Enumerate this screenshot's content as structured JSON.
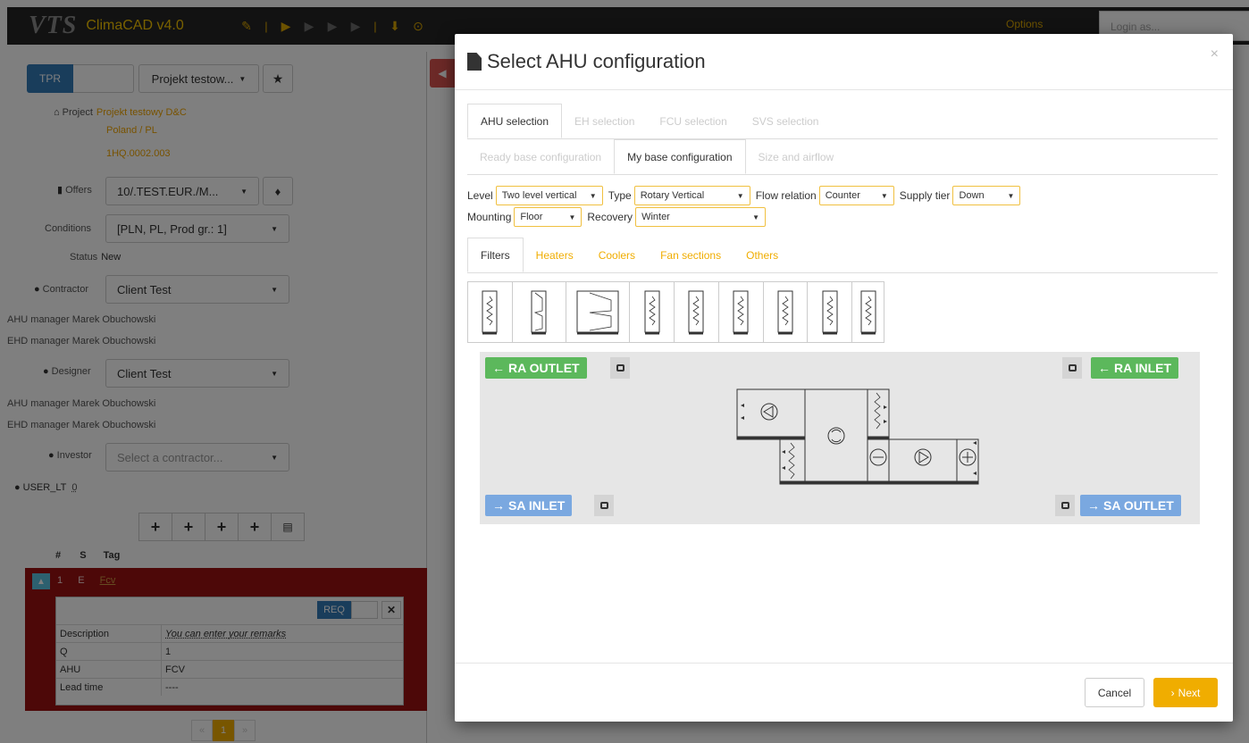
{
  "topbar": {
    "logo": "VTS",
    "title": "ClimaCAD v4.0",
    "options_label": "Options",
    "login_placeholder": "Login as..."
  },
  "left": {
    "tpr_label": "TPR",
    "project_button": "Projekt testow...",
    "project_label": "Project",
    "project_name": "Projekt testowy D&C",
    "project_country": "Poland / PL",
    "project_code": "1HQ.0002.003",
    "offers_label": "Offers",
    "offers_value": "10/.TEST.EUR./M...",
    "conditions_label": "Conditions",
    "conditions_value": "[PLN, PL, Prod gr.: 1]",
    "status_label": "Status",
    "status_value": "New",
    "contractor_label": "Contractor",
    "contractor_value": "Client Test",
    "contractor_ahu": "AHU manager Marek Obuchowski",
    "contractor_ehd": "EHD manager Marek Obuchowski",
    "designer_label": "Designer",
    "designer_value": "Client Test",
    "designer_ahu": "AHU manager Marek Obuchowski",
    "designer_ehd": "EHD manager Marek Obuchowski",
    "investor_label": "Investor",
    "investor_placeholder": "Select a contractor...",
    "user_label": "USER_LT",
    "user_value": "0",
    "table_headers": {
      "hash": "#",
      "s": "S",
      "tag": "Tag"
    },
    "row": {
      "num": "1",
      "s": "E",
      "tag": "Fcv"
    },
    "req_label": "REQ",
    "details": [
      {
        "key": "Description",
        "value": "You can enter your remarks"
      },
      {
        "key": "Q",
        "value": "1"
      },
      {
        "key": "AHU",
        "value": "FCV"
      },
      {
        "key": "Lead time",
        "value": "----"
      }
    ],
    "page": "1"
  },
  "modal": {
    "title": "Select AHU configuration",
    "close": "×",
    "tabs_top": [
      "AHU selection",
      "EH selection",
      "FCU selection",
      "SVS selection"
    ],
    "tabs_second": [
      "Ready base configuration",
      "My base configuration",
      "Size and airflow"
    ],
    "level_label": "Level",
    "level_value": "Two level vertical",
    "type_label": "Type",
    "type_value": "Rotary Vertical",
    "flow_label": "Flow relation",
    "flow_value": "Counter",
    "supply_label": "Supply tier",
    "supply_value": "Down",
    "mounting_label": "Mounting",
    "mounting_value": "Floor",
    "recovery_label": "Recovery",
    "recovery_value": "Winter",
    "component_tabs": [
      "Filters",
      "Heaters",
      "Coolers",
      "Fan sections",
      "Others"
    ],
    "ra_outlet": "RA OUTLET",
    "ra_inlet": "RA INLET",
    "sa_inlet": "SA INLET",
    "sa_outlet": "SA OUTLET",
    "cancel": "Cancel",
    "next": "Next"
  },
  "colors": {
    "accent": "#f0ad00",
    "primary": "#337ab7",
    "green": "#5cb85c",
    "blue": "#7aa8e0",
    "danger": "#9b1111"
  }
}
